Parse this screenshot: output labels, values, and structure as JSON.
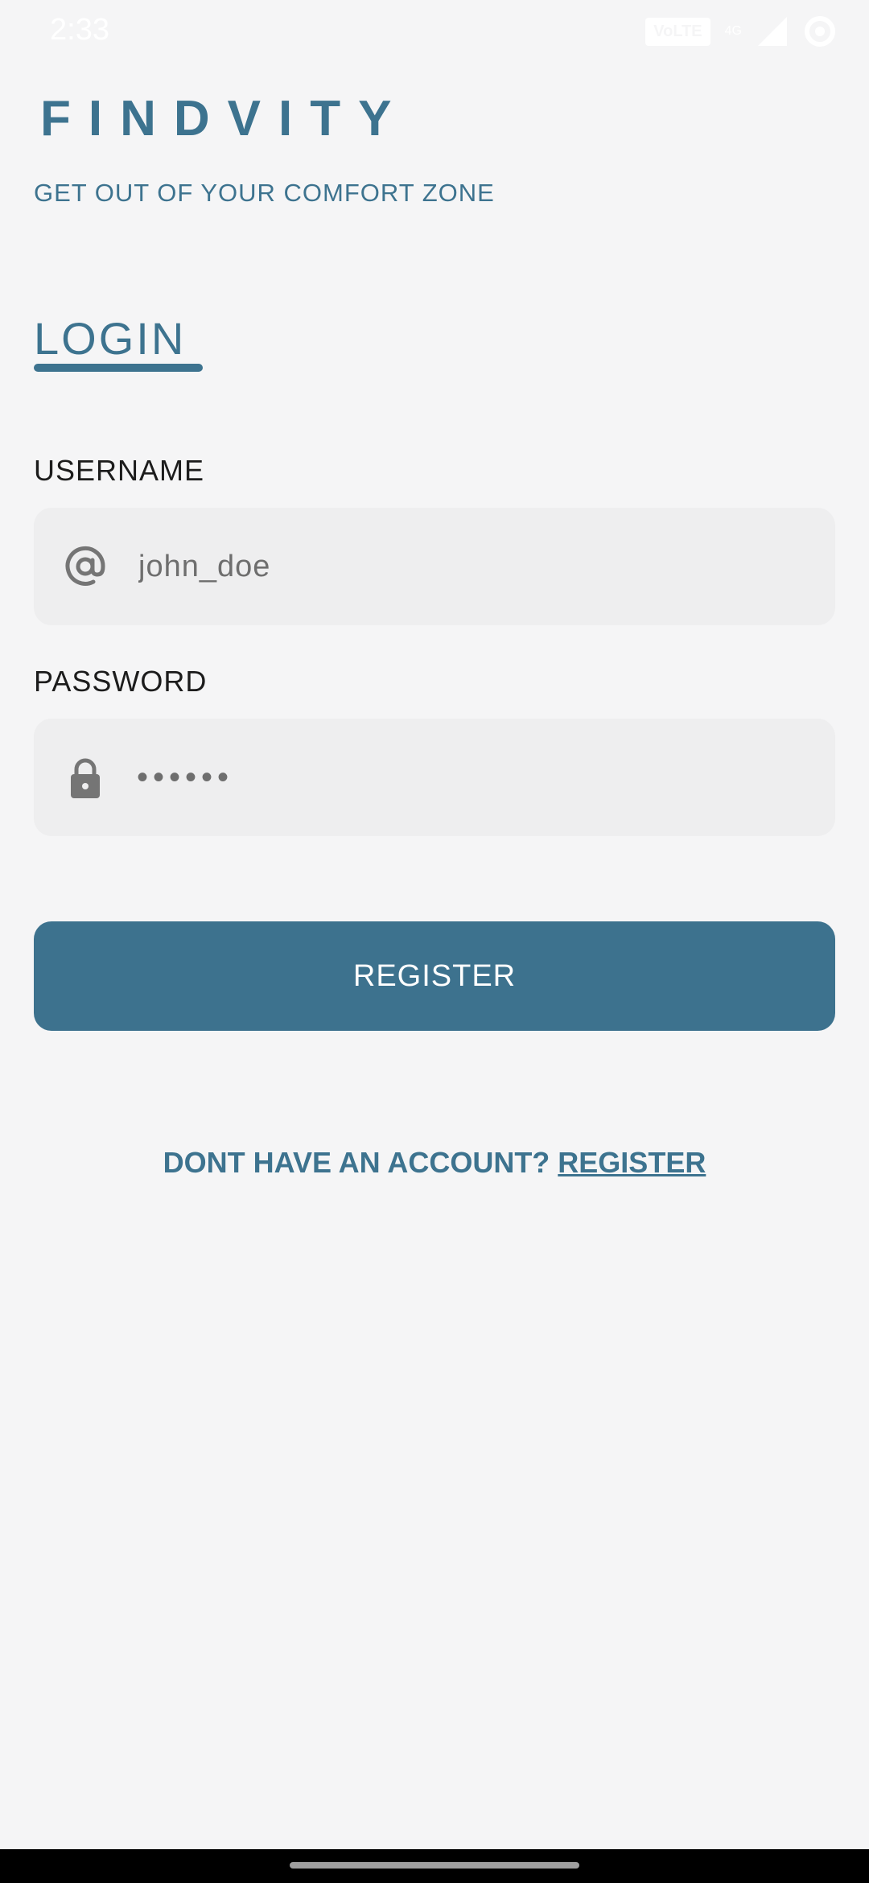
{
  "status_bar": {
    "time": "2:33",
    "network_badge": "VoLTE",
    "network_type": "4G"
  },
  "brand": {
    "name": "FINDVITY",
    "tagline": "GET OUT OF YOUR COMFORT ZONE"
  },
  "login": {
    "title": "LOGIN",
    "username_label": "USERNAME",
    "username_value": "john_doe",
    "password_label": "PASSWORD",
    "password_masked": "••••••",
    "submit_label": "REGISTER",
    "signup_prompt": "DONT HAVE AN ACCOUNT?",
    "signup_link": "REGISTER"
  },
  "icons": {
    "username": "at-icon",
    "password": "lock-icon"
  },
  "colors": {
    "accent": "#3d738f",
    "background": "#f5f5f6",
    "field_background": "#eeeeef"
  }
}
